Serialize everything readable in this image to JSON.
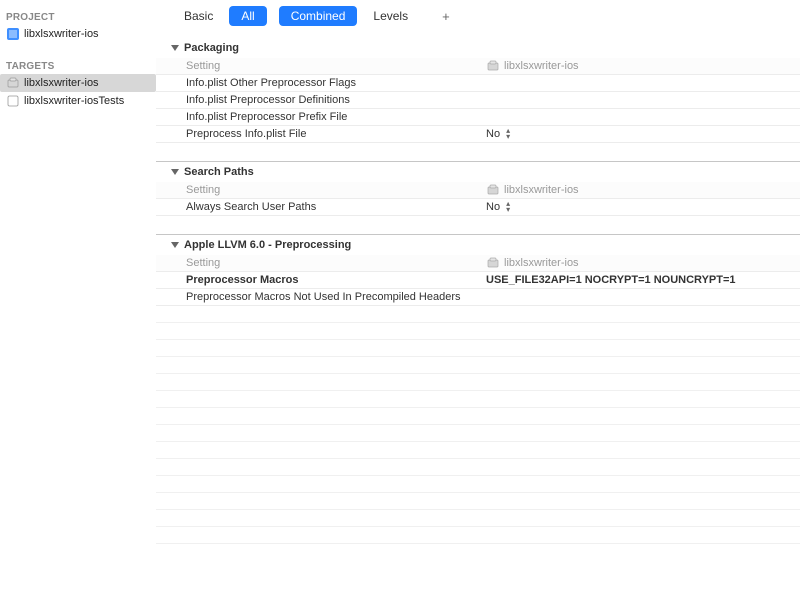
{
  "sidebar": {
    "project_heading": "PROJECT",
    "project_item": "libxlsxwriter-ios",
    "targets_heading": "TARGETS",
    "targets": [
      {
        "label": "libxlsxwriter-ios"
      },
      {
        "label": "libxlsxwriter-iosTests"
      }
    ]
  },
  "tabs": {
    "basic": "Basic",
    "all": "All",
    "combined": "Combined",
    "levels": "Levels"
  },
  "section_column_setting": "Setting",
  "target_name": "libxlsxwriter-ios",
  "sections": {
    "packaging": {
      "title": "Packaging",
      "rows": [
        {
          "setting": "Info.plist Other Preprocessor Flags",
          "value": ""
        },
        {
          "setting": "Info.plist Preprocessor Definitions",
          "value": ""
        },
        {
          "setting": "Info.plist Preprocessor Prefix File",
          "value": ""
        },
        {
          "setting": "Preprocess Info.plist File",
          "value": "No"
        }
      ]
    },
    "search_paths": {
      "title": "Search Paths",
      "rows": [
        {
          "setting": "Always Search User Paths",
          "value": "No"
        }
      ]
    },
    "llvm": {
      "title": "Apple LLVM 6.0 - Preprocessing",
      "rows": [
        {
          "setting": "Preprocessor Macros",
          "value": "USE_FILE32API=1 NOCRYPT=1 NOUNCRYPT=1",
          "bold": true
        },
        {
          "setting": "Preprocessor Macros Not Used In Precompiled Headers",
          "value": ""
        }
      ]
    }
  }
}
